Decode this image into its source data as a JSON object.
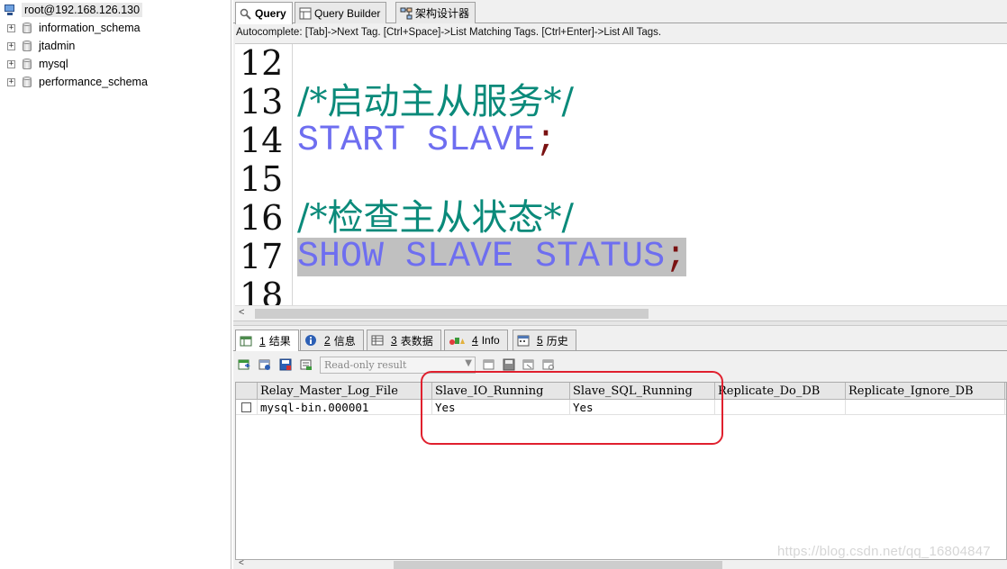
{
  "connection": {
    "root_label": "root@192.168.126.130",
    "databases": [
      "information_schema",
      "jtadmin",
      "mysql",
      "performance_schema"
    ],
    "expander_symbol": "+"
  },
  "tabs": [
    {
      "label": "Query",
      "active": true
    },
    {
      "label": "Query Builder",
      "active": false
    },
    {
      "label": "架构设计器",
      "active": false
    }
  ],
  "autocomplete_hint": "Autocomplete: [Tab]->Next Tag. [Ctrl+Space]->List Matching Tags. [Ctrl+Enter]->List All Tags.",
  "editor": {
    "lines": [
      {
        "num": "12",
        "text": "",
        "kind": "plain"
      },
      {
        "num": "13",
        "text": "/*启动主从服务*/",
        "kind": "comment"
      },
      {
        "num": "14",
        "text": "START SLAVE",
        "semi": ";",
        "kind": "kw"
      },
      {
        "num": "15",
        "text": "",
        "kind": "plain"
      },
      {
        "num": "16",
        "text": "/*检查主从状态*/",
        "kind": "comment"
      },
      {
        "num": "17",
        "text": "SHOW SLAVE STATUS",
        "semi": ";",
        "kind": "kw",
        "selected": true
      },
      {
        "num": "18",
        "text": "",
        "kind": "plain"
      }
    ]
  },
  "result_tabs": [
    {
      "num": "1",
      "label": "结果",
      "active": true
    },
    {
      "num": "2",
      "label": "信息",
      "active": false
    },
    {
      "num": "3",
      "label": "表数据",
      "active": false
    },
    {
      "num": "4",
      "label": "Info",
      "active": false
    },
    {
      "num": "5",
      "label": "历史",
      "active": false
    }
  ],
  "result_toolbar": {
    "mode_select": "Read-only result"
  },
  "result_grid": {
    "columns": [
      "Relay_Master_Log_File",
      "Slave_IO_Running",
      "Slave_SQL_Running",
      "Replicate_Do_DB",
      "Replicate_Ignore_DB"
    ],
    "rows": [
      [
        "mysql-bin.000001",
        "Yes",
        "Yes",
        "",
        ""
      ]
    ]
  },
  "watermark": "https://blog.csdn.net/qq_16804847",
  "colors": {
    "comment": "#0a8a7a",
    "keyword": "#6e6ef0",
    "semicolon": "#7a1212",
    "annotation": "#e0202e"
  }
}
